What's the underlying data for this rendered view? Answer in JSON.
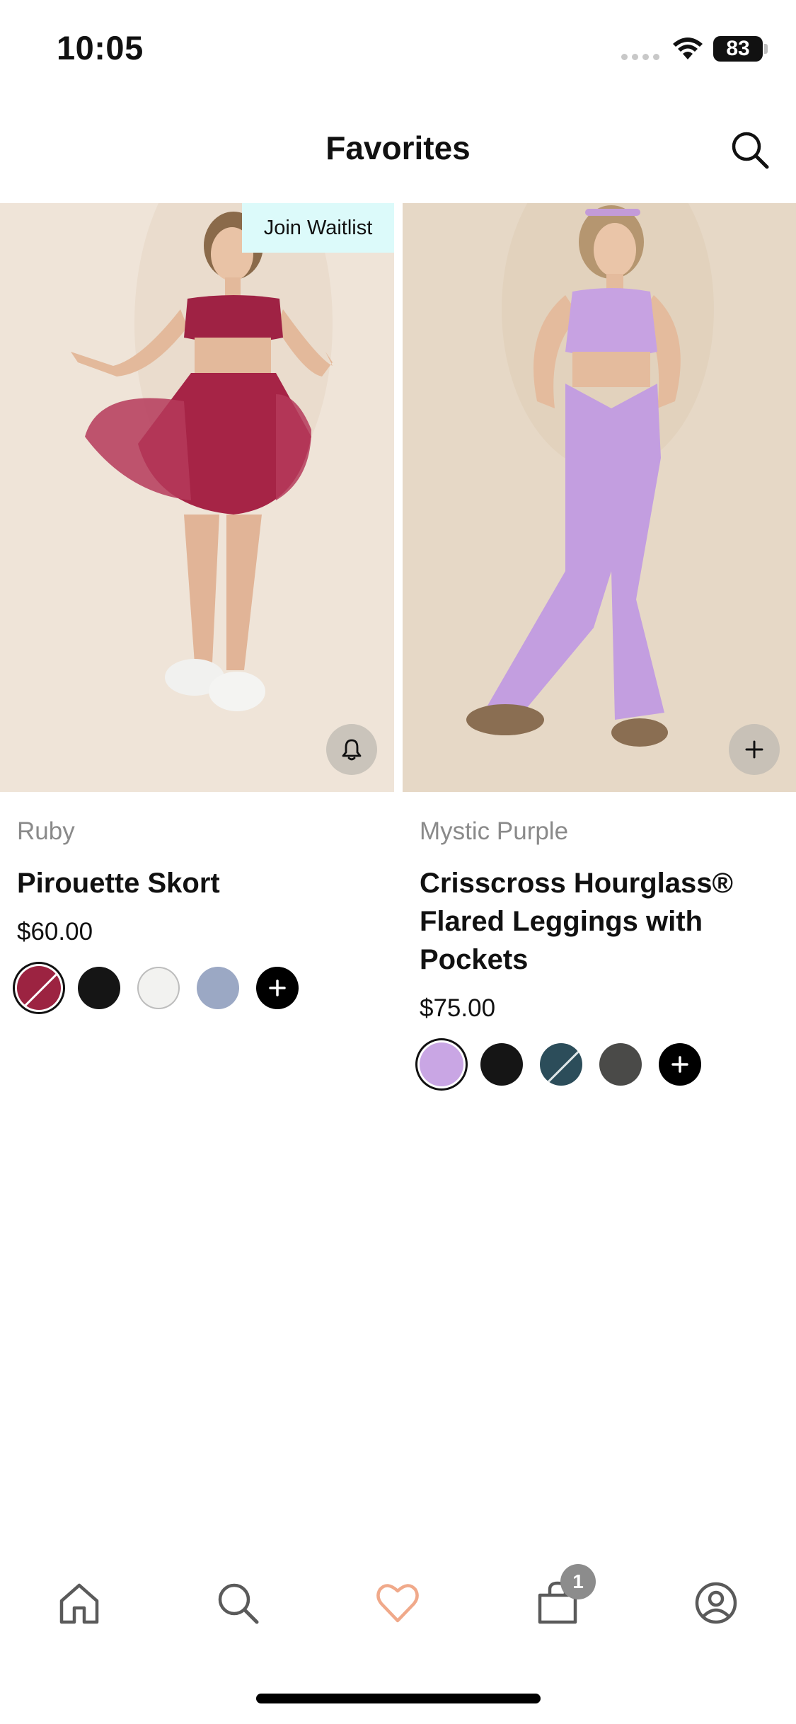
{
  "status_bar": {
    "time": "10:05",
    "battery": "83"
  },
  "header": {
    "title": "Favorites",
    "search_icon": "search-icon"
  },
  "products": [
    {
      "color_name": "Ruby",
      "name": "Pirouette Skort",
      "price": "$60.00",
      "badge": "Join Waitlist",
      "action_icon": "bell-icon",
      "swatches": [
        {
          "color": "#9c2341",
          "selected": true,
          "unavailable": true
        },
        {
          "color": "#151515",
          "selected": false
        },
        {
          "color": "#f2f2f0",
          "selected": false
        },
        {
          "color": "#9ba8c4",
          "selected": false
        },
        {
          "more": true,
          "icon": "plus-icon"
        }
      ]
    },
    {
      "color_name": "Mystic Purple",
      "name": "Crisscross Hourglass® Flared Leggings with Pockets",
      "price": "$75.00",
      "action_icon": "plus-icon",
      "swatches": [
        {
          "color": "#c9a6e4",
          "selected": true
        },
        {
          "color": "#151515",
          "selected": false
        },
        {
          "color": "#2c4d5a",
          "selected": false,
          "unavailable": true
        },
        {
          "color": "#4a4a48",
          "selected": false
        },
        {
          "more": true,
          "icon": "plus-icon"
        }
      ]
    }
  ],
  "bottom_nav": {
    "items": [
      "home-icon",
      "search-icon",
      "heart-icon",
      "shopping-bag-icon",
      "account-icon"
    ],
    "active": "heart-icon",
    "active_color": "#f0a98a",
    "cart_count": "1"
  }
}
